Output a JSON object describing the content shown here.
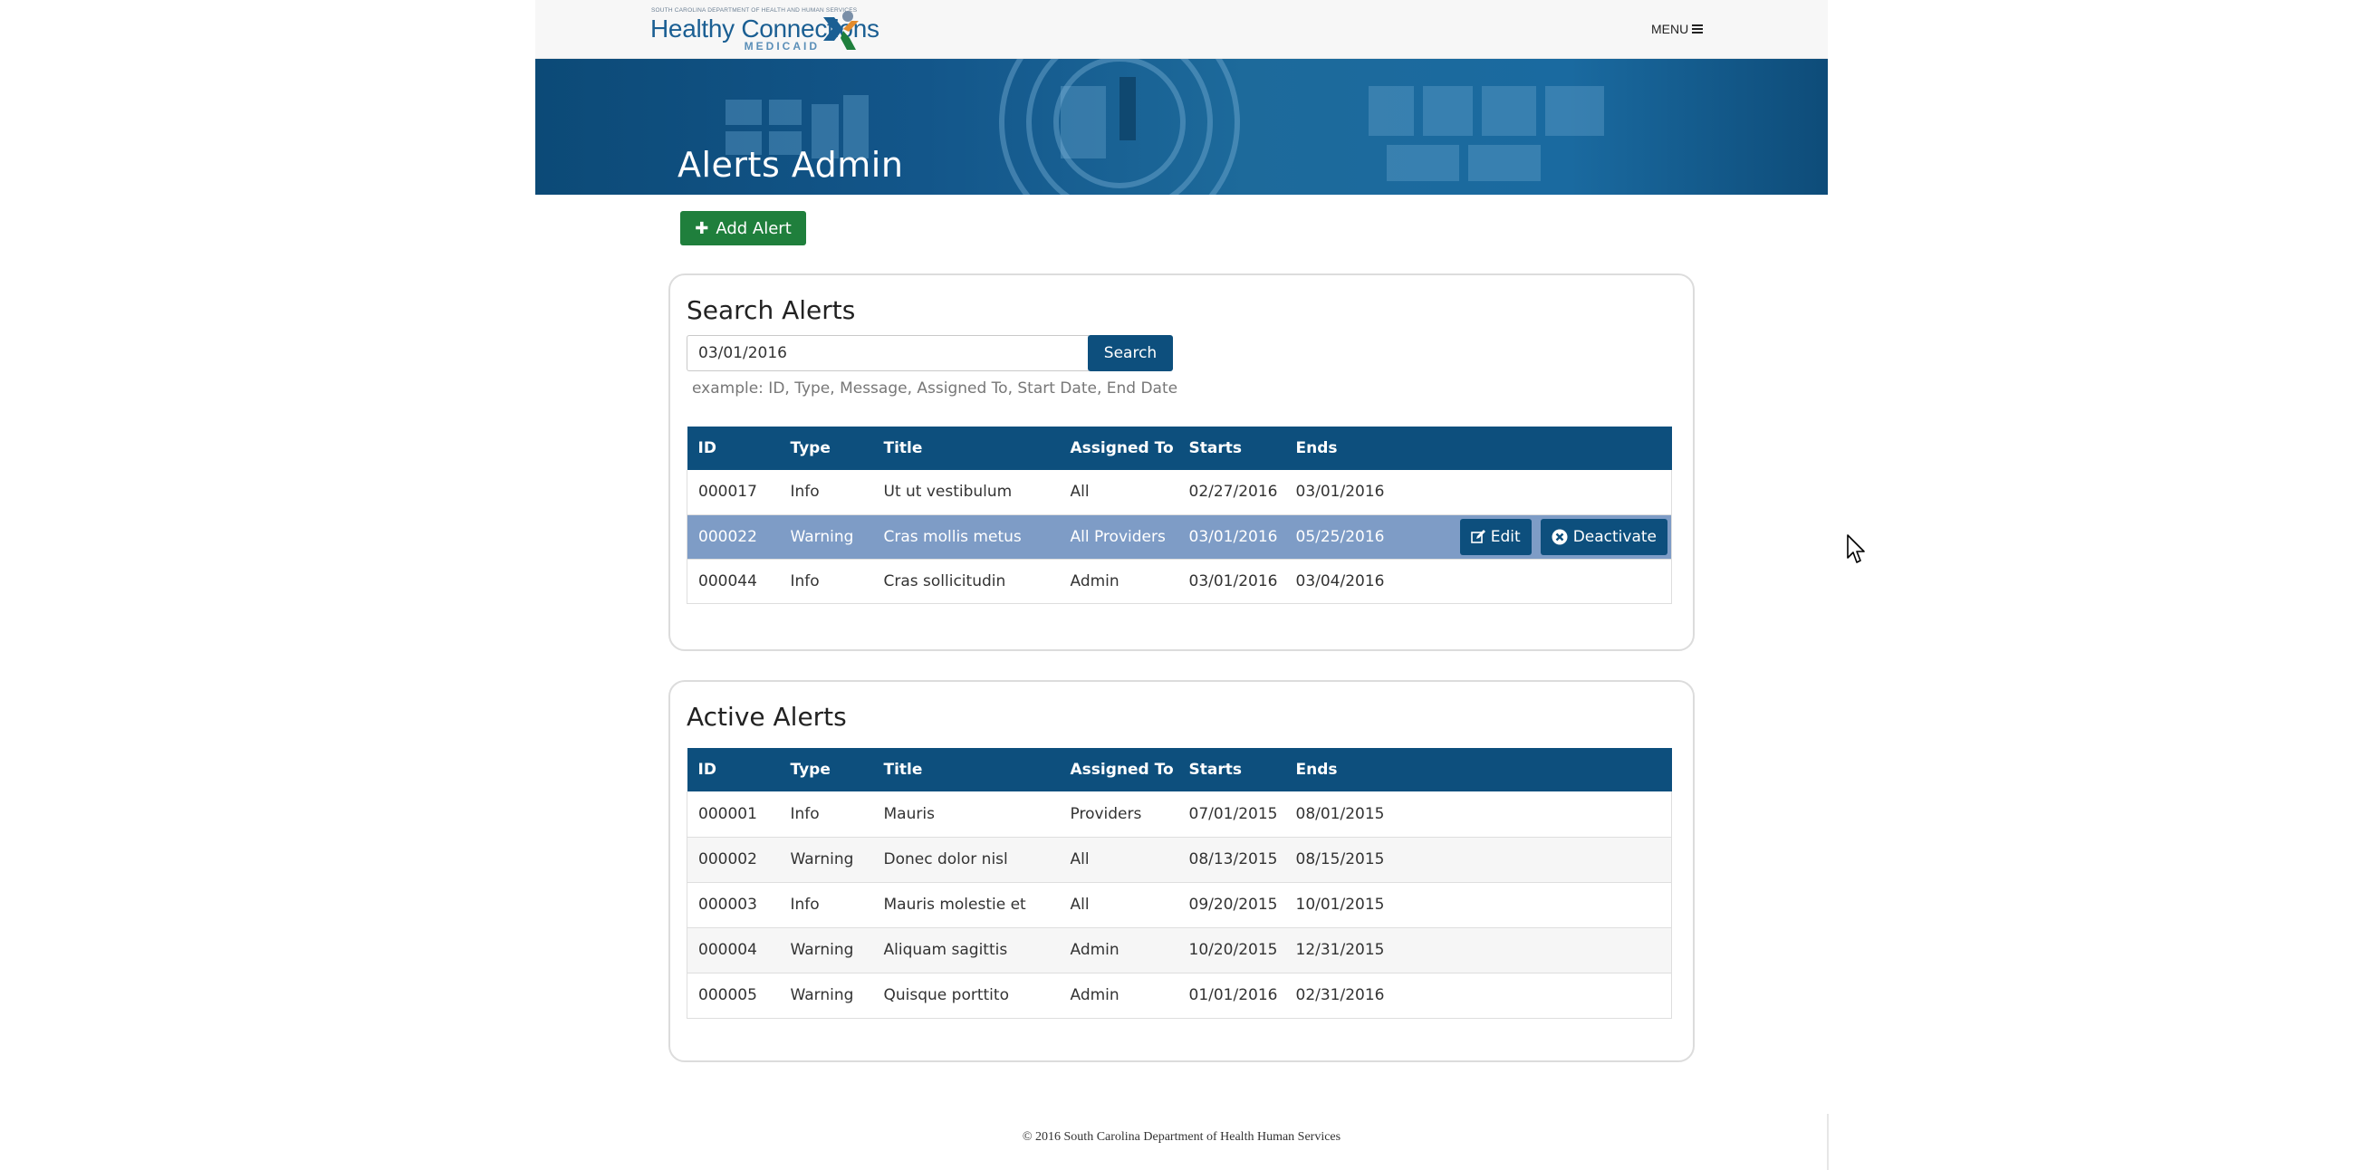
{
  "header": {
    "logo_dept": "SOUTH CAROLINA DEPARTMENT OF HEALTH AND HUMAN SERVICES",
    "logo_main": "Healthy Connections",
    "logo_sub": "MEDICAID",
    "menu_label": "MENU",
    "brand_colors": {
      "blue": "#1b5f93",
      "orange": "#e38b2c",
      "green": "#1f7f3c",
      "slate": "#6b7f93"
    }
  },
  "banner": {
    "title": "Alerts Admin"
  },
  "add_button": {
    "label": "Add Alert",
    "icon": "plus-icon"
  },
  "search": {
    "heading": "Search Alerts",
    "input_value": "03/01/2016",
    "button_label": "Search",
    "hint": "example: ID, Type, Message, Assigned To, Start Date, End Date",
    "columns": [
      "ID",
      "Type",
      "Title",
      "Assigned To",
      "Starts",
      "Ends"
    ],
    "rows": [
      {
        "id": "000017",
        "type": "Info",
        "title": "Ut ut vestibulum",
        "assigned": "All",
        "starts": "02/27/2016",
        "ends": "03/01/2016"
      },
      {
        "id": "000022",
        "type": "Warning",
        "title": "Cras mollis metus",
        "assigned": "All Providers",
        "starts": "03/01/2016",
        "ends": "05/25/2016",
        "selected": true
      },
      {
        "id": "000044",
        "type": "Info",
        "title": "Cras sollicitudin",
        "assigned": "Admin",
        "starts": "03/01/2016",
        "ends": "03/04/2016"
      }
    ],
    "row_actions": {
      "edit": "Edit",
      "deactivate": "Deactivate"
    }
  },
  "active": {
    "heading": "Active Alerts",
    "columns": [
      "ID",
      "Type",
      "Title",
      "Assigned To",
      "Starts",
      "Ends"
    ],
    "rows": [
      {
        "id": "000001",
        "type": "Info",
        "title": "Mauris",
        "assigned": "Providers",
        "starts": "07/01/2015",
        "ends": "08/01/2015"
      },
      {
        "id": "000002",
        "type": "Warning",
        "title": "Donec dolor nisl",
        "assigned": "All",
        "starts": "08/13/2015",
        "ends": "08/15/2015"
      },
      {
        "id": "000003",
        "type": "Info",
        "title": "Mauris molestie et",
        "assigned": "All",
        "starts": "09/20/2015",
        "ends": "10/01/2015"
      },
      {
        "id": "000004",
        "type": "Warning",
        "title": "Aliquam sagittis",
        "assigned": "Admin",
        "starts": "10/20/2015",
        "ends": "12/31/2015"
      },
      {
        "id": "000005",
        "type": "Warning",
        "title": "Quisque porttito",
        "assigned": "Admin",
        "starts": "01/01/2016",
        "ends": "02/31/2016"
      }
    ]
  },
  "footer": {
    "text": "© 2016 South Carolina Department of Health Human Services"
  }
}
